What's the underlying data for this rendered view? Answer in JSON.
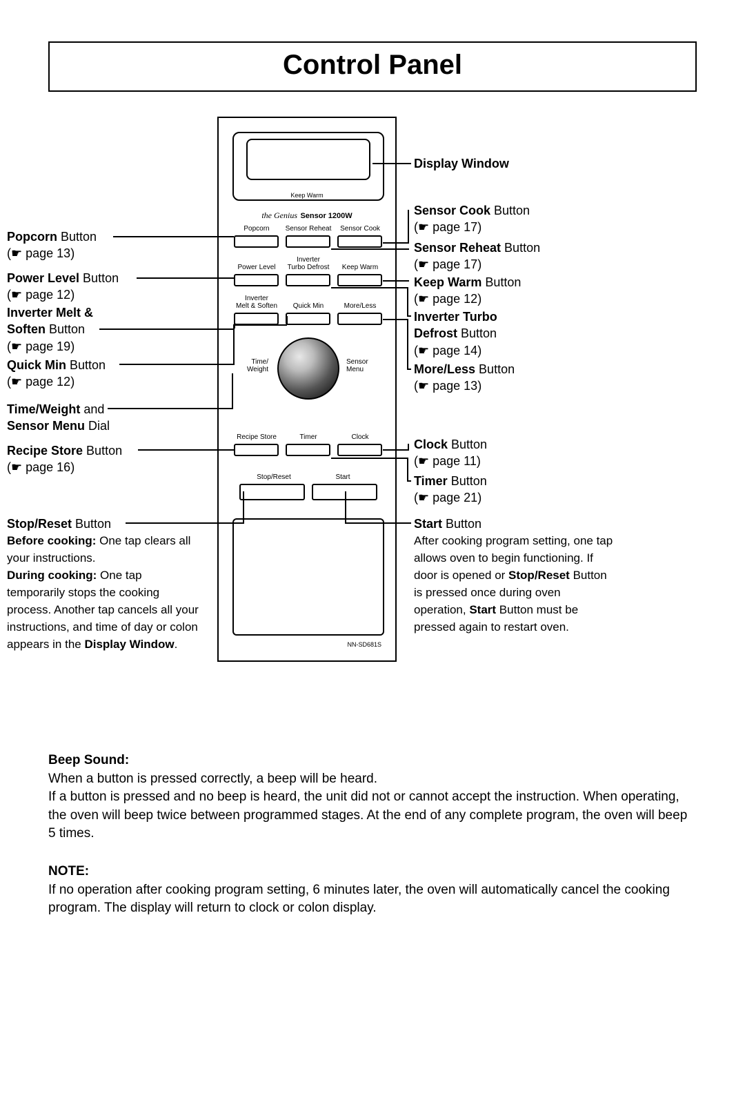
{
  "title": "Control Panel",
  "panel": {
    "keep_warm_small": "Keep Warm",
    "genius": "the Genius",
    "sensor_wattage": "Sensor 1200W",
    "row1": {
      "popcorn": "Popcorn",
      "sensor_reheat": "Sensor Reheat",
      "sensor_cook": "Sensor Cook"
    },
    "row2": {
      "power_level": "Power Level",
      "turbo_defrost_top": "Inverter",
      "turbo_defrost": "Turbo Defrost",
      "keep_warm": "Keep Warm"
    },
    "row3": {
      "melt_soften_top": "Inverter",
      "melt_soften": "Melt & Soften",
      "quick_min": "Quick Min",
      "more_less": "More/Less"
    },
    "dial": {
      "left_top": "Time/",
      "left_bot": "Weight",
      "right_top": "Sensor",
      "right_bot": "Menu"
    },
    "row4": {
      "recipe_store": "Recipe Store",
      "timer": "Timer",
      "clock": "Clock"
    },
    "row5": {
      "stop_reset": "Stop/Reset",
      "start": "Start"
    },
    "model": "NN-SD681S"
  },
  "left": {
    "popcorn": {
      "t1b": "Popcorn",
      "t1": " Button",
      "t2": "(☛ page 13)"
    },
    "power": {
      "t1b": "Power Level",
      "t1": " Button",
      "t2": "(☛ page 12)"
    },
    "melt": {
      "t1b": "Inverter Melt &",
      "t2b": "Soften",
      "t2": " Button",
      "t3": "(☛ page 19)"
    },
    "quick": {
      "t1b": "Quick Min",
      "t1": " Button",
      "t2": "(☛ page 12)"
    },
    "dial": {
      "t1b": "Time/Weight",
      "t1": " and",
      "t2b": "Sensor Menu",
      "t2": " Dial"
    },
    "recipe": {
      "t1b": "Recipe Store",
      "t1": " Button",
      "t2": "(☛ page 16)"
    },
    "stop": {
      "t1b": "Stop/Reset",
      "t1": " Button",
      "p1b": "Before cooking:",
      "p1": " One tap clears all your instructions.",
      "p2b": "During cooking:",
      "p2": " One tap temporarily stops the cooking process. Another tap cancels all your instructions, and time of day or colon appears in the ",
      "p3b": "Display Window",
      "p3": "."
    }
  },
  "right": {
    "display": {
      "t1b": "Display Window"
    },
    "scook": {
      "t1b": "Sensor Cook",
      "t1": " Button",
      "t2": "(☛ page 17)"
    },
    "sreheat": {
      "t1b": "Sensor Reheat",
      "t1": " Button",
      "t2": "(☛ page 17)"
    },
    "keepwarm": {
      "t1b": "Keep Warm",
      "t1": " Button",
      "t2": "(☛ page 12)"
    },
    "turbo": {
      "t1b": "Inverter Turbo",
      "t2b": "Defrost",
      "t2": " Button",
      "t3": "(☛ page 14)"
    },
    "moreless": {
      "t1b": "More/Less",
      "t1": " Button",
      "t2": "(☛ page 13)"
    },
    "clock": {
      "t1b": "Clock",
      "t1": " Button",
      "t2": "(☛ page 11)"
    },
    "timer": {
      "t1b": "Timer",
      "t1": " Button",
      "t2": "(☛ page 21)"
    },
    "start": {
      "t1b": "Start",
      "t1": " Button",
      "p1": "After cooking program setting, one tap allows oven to begin functioning. If door is opened or ",
      "p2b": "Stop/Reset",
      "p2": " Button is pressed once during oven operation, ",
      "p3b": "Start",
      "p3": " Button must be pressed again to restart oven."
    }
  },
  "body": {
    "beep_hd": "Beep Sound:",
    "beep_p": "When a button is pressed correctly, a beep will be heard.\nIf a button is pressed and no beep is heard, the unit did not or cannot accept the instruction. When operating, the oven will beep twice between programmed stages. At the end of any complete program, the oven will beep 5 times.",
    "note_hd": "NOTE:",
    "note_p": "If no operation after cooking program setting, 6 minutes later, the oven will automatically cancel the cooking program. The display will return to clock or colon display."
  }
}
